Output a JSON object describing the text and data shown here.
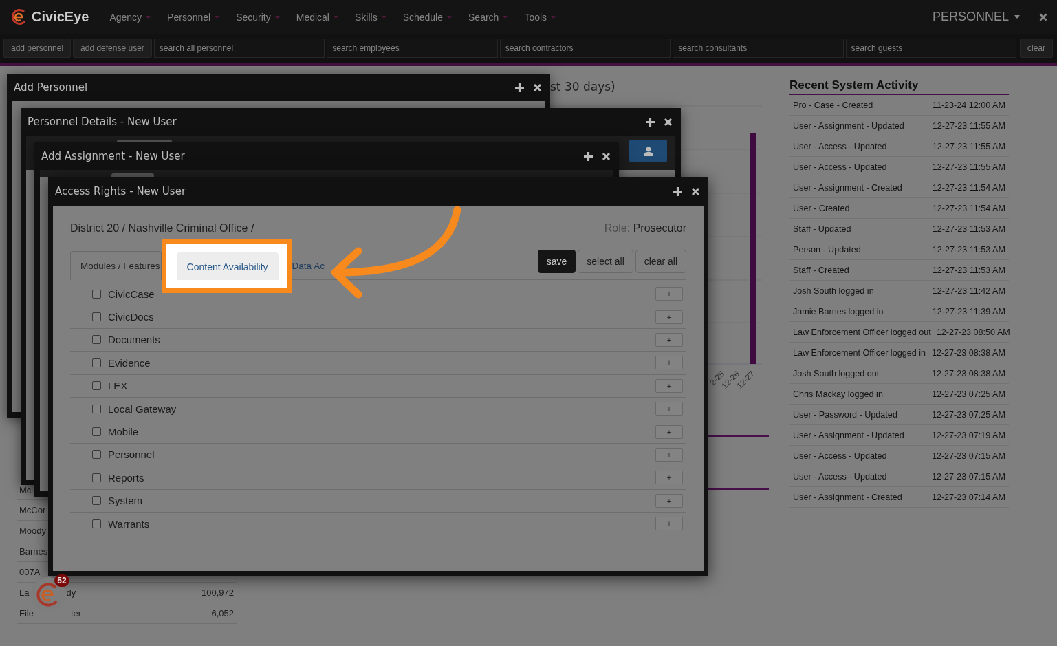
{
  "app_bar": {
    "brand": "CivicEye",
    "menus": [
      {
        "label": "Agency"
      },
      {
        "label": "Personnel"
      },
      {
        "label": "Security"
      },
      {
        "label": "Medical"
      },
      {
        "label": "Skills"
      },
      {
        "label": "Schedule"
      },
      {
        "label": "Search"
      },
      {
        "label": "Tools"
      }
    ],
    "context": "PERSONNEL"
  },
  "quick_bar": {
    "buttons": [
      "add personnel",
      "add defense user"
    ],
    "search_fields": [
      {
        "placeholder": "search all personnel"
      },
      {
        "placeholder": "search employees"
      },
      {
        "placeholder": "search contractors"
      },
      {
        "placeholder": "search consultants"
      },
      {
        "placeholder": "search guests"
      }
    ],
    "clear_button": "clear"
  },
  "background": {
    "chart": {
      "title": "st 30 days)",
      "x_labels": [
        "2-25",
        "12-26",
        "12-27"
      ]
    },
    "left_table": {
      "rows": [
        {
          "label": "Mc"
        },
        {
          "label": "McCor"
        },
        {
          "label": "Moody"
        },
        {
          "label": "Barnes"
        },
        {
          "label": "007A"
        },
        {
          "label": "La",
          "label_end": "dy",
          "value": "100,972"
        },
        {
          "label": "File",
          "label_end": "ter",
          "value": "6,052"
        }
      ]
    },
    "activity": {
      "title": "Recent System Activity",
      "rows": [
        {
          "event": "Pro - Case - Created",
          "time": "11-23-24 12:00 AM"
        },
        {
          "event": "User - Assignment - Updated",
          "time": "12-27-23 11:55 AM"
        },
        {
          "event": "User - Access - Updated",
          "time": "12-27-23 11:55 AM"
        },
        {
          "event": "User - Access - Updated",
          "time": "12-27-23 11:55 AM"
        },
        {
          "event": "User - Assignment - Created",
          "time": "12-27-23 11:54 AM"
        },
        {
          "event": "User - Created",
          "time": "12-27-23 11:54 AM"
        },
        {
          "event": "Staff - Updated",
          "time": "12-27-23 11:53 AM"
        },
        {
          "event": "Person - Updated",
          "time": "12-27-23 11:53 AM"
        },
        {
          "event": "Staff - Created",
          "time": "12-27-23 11:53 AM"
        },
        {
          "event": "Josh South logged in",
          "time": "12-27-23 11:42 AM"
        },
        {
          "event": "Jamie Barnes logged in",
          "time": "12-27-23 11:39 AM"
        },
        {
          "event": "Law Enforcement Officer logged out",
          "time": "12-27-23 08:50 AM"
        },
        {
          "event": "Law Enforcement Officer logged in",
          "time": "12-27-23 08:38 AM"
        },
        {
          "event": "Josh South logged out",
          "time": "12-27-23 08:38 AM"
        },
        {
          "event": "Chris Mackay logged in",
          "time": "12-27-23 07:25 AM"
        },
        {
          "event": "User - Password - Updated",
          "time": "12-27-23 07:25 AM"
        },
        {
          "event": "User - Assignment - Updated",
          "time": "12-27-23 07:19 AM"
        },
        {
          "event": "User - Access - Updated",
          "time": "12-27-23 07:15 AM"
        },
        {
          "event": "User - Access - Updated",
          "time": "12-27-23 07:15 AM"
        },
        {
          "event": "User - Assignment - Created",
          "time": "12-27-23 07:14 AM"
        }
      ]
    }
  },
  "windows": [
    {
      "title": "Add Personnel",
      "kind": "plain"
    },
    {
      "title": "Personnel Details - New User",
      "kind": "toolbar"
    },
    {
      "title": "Add Assignment - New User",
      "kind": "strip"
    }
  ],
  "access_rights": {
    "title": "Access Rights - New User",
    "breadcrumb": "District 20 / Nashville Criminal Office /",
    "role_label": "Role:",
    "role": "Prosecutor",
    "tabs": [
      {
        "label": "Modules / Features",
        "selected": true,
        "highlighted": false
      },
      {
        "label": "Content Availability",
        "selected": false,
        "highlighted": true
      },
      {
        "label": "Data Ac",
        "selected": false,
        "highlighted": false
      }
    ],
    "buttons": [
      {
        "label": "save",
        "kind": "primary"
      },
      {
        "label": "select all",
        "kind": "default"
      },
      {
        "label": "clear all",
        "kind": "default"
      }
    ],
    "modules": [
      {
        "label": "CivicCase",
        "checked": false,
        "toggle": "+"
      },
      {
        "label": "CivicDocs",
        "checked": false,
        "toggle": "+"
      },
      {
        "label": "Documents",
        "checked": false,
        "toggle": "+"
      },
      {
        "label": "Evidence",
        "checked": false,
        "toggle": "+"
      },
      {
        "label": "LEX",
        "checked": false,
        "toggle": "+"
      },
      {
        "label": "Local Gateway",
        "checked": false,
        "toggle": "+"
      },
      {
        "label": "Mobile",
        "checked": false,
        "toggle": "+"
      },
      {
        "label": "Personnel",
        "checked": false,
        "toggle": "+"
      },
      {
        "label": "Reports",
        "checked": false,
        "toggle": "+"
      },
      {
        "label": "System",
        "checked": false,
        "toggle": "+"
      },
      {
        "label": "Warrants",
        "checked": false,
        "toggle": "+"
      }
    ]
  },
  "notification_badge": "52"
}
